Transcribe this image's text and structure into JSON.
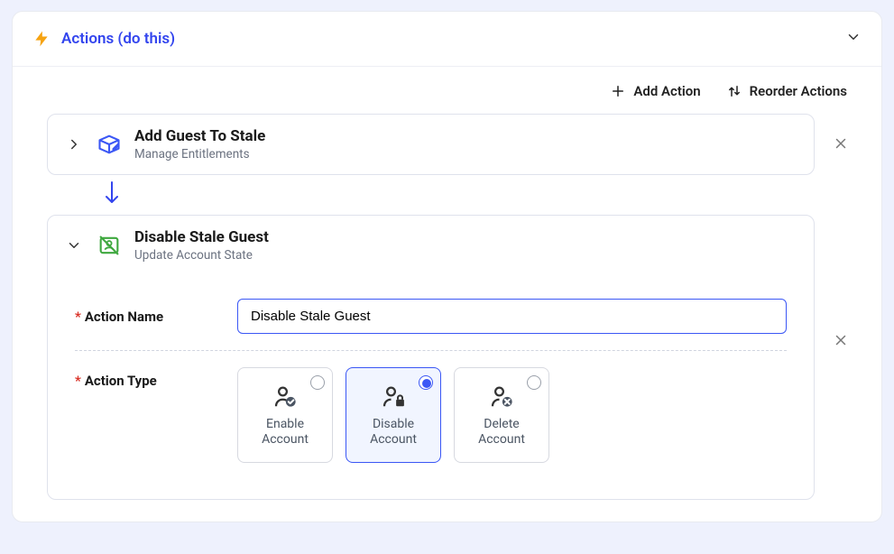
{
  "section": {
    "title": "Actions (do this)"
  },
  "toolbar": {
    "add": "Add Action",
    "reorder": "Reorder Actions"
  },
  "actions": [
    {
      "title": "Add Guest To Stale",
      "subtitle": "Manage Entitlements"
    },
    {
      "title": "Disable Stale Guest",
      "subtitle": "Update Account State"
    }
  ],
  "form": {
    "nameLabel": "Action Name",
    "nameValue": "Disable Stale Guest",
    "typeLabel": "Action Type",
    "types": [
      {
        "label": "Enable Account"
      },
      {
        "label": "Disable Account",
        "selected": true
      },
      {
        "label": "Delete Account"
      }
    ]
  }
}
